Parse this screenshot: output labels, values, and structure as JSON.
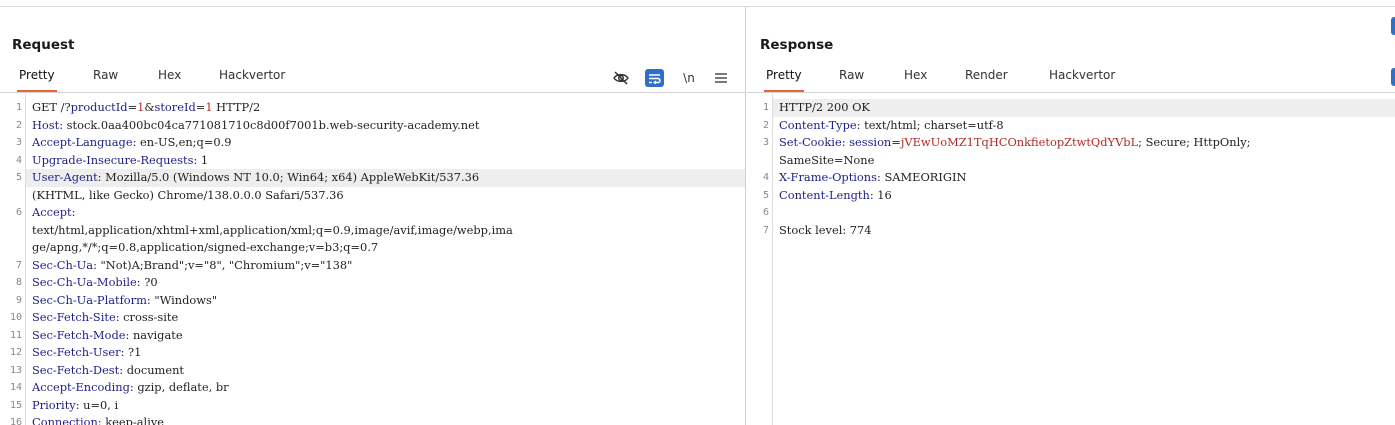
{
  "request": {
    "title": "Request",
    "tabs": [
      "Pretty",
      "Raw",
      "Hex",
      "Hackvertor"
    ],
    "active_tab": "Pretty",
    "toolbar": {
      "newline_label": "\\n"
    },
    "lines": [
      {
        "n": "1",
        "parts": [
          [
            "t",
            "GET /?"
          ],
          [
            "p",
            "productId"
          ],
          [
            "t",
            "="
          ],
          [
            "v",
            "1"
          ],
          [
            "t",
            "&"
          ],
          [
            "p",
            "storeId"
          ],
          [
            "t",
            "="
          ],
          [
            "v",
            "1"
          ],
          [
            "t",
            " HTTP/2"
          ]
        ]
      },
      {
        "n": "2",
        "parts": [
          [
            "h",
            "Host"
          ],
          [
            "t",
            ": stock.0aa400bc04ca771081710c8d00f7001b.web-security-academy.net"
          ]
        ]
      },
      {
        "n": "3",
        "parts": [
          [
            "h",
            "Accept-Language"
          ],
          [
            "t",
            ": en-US,en;q=0.9"
          ]
        ]
      },
      {
        "n": "4",
        "parts": [
          [
            "h",
            "Upgrade-Insecure-Requests"
          ],
          [
            "t",
            ": 1"
          ]
        ]
      },
      {
        "n": "5",
        "parts": [
          [
            "h",
            "User-Agent"
          ],
          [
            "t",
            ": Mozilla/5.0 (Windows NT 10.0; Win64; x64) AppleWebKit/537.36"
          ]
        ],
        "hl": true
      },
      {
        "n": "",
        "parts": [
          [
            "t",
            "(KHTML, like Gecko) Chrome/138.0.0.0 Safari/537.36"
          ]
        ]
      },
      {
        "n": "6",
        "parts": [
          [
            "h",
            "Accept"
          ],
          [
            "t",
            ":"
          ]
        ]
      },
      {
        "n": "",
        "parts": [
          [
            "t",
            "text/html,application/xhtml+xml,application/xml;q=0.9,image/avif,image/webp,ima"
          ]
        ]
      },
      {
        "n": "",
        "parts": [
          [
            "t",
            "ge/apng,*/*;q=0.8,application/signed-exchange;v=b3;q=0.7"
          ]
        ]
      },
      {
        "n": "7",
        "parts": [
          [
            "h",
            "Sec-Ch-Ua"
          ],
          [
            "t",
            ": \"Not)A;Brand\";v=\"8\", \"Chromium\";v=\"138\""
          ]
        ]
      },
      {
        "n": "8",
        "parts": [
          [
            "h",
            "Sec-Ch-Ua-Mobile"
          ],
          [
            "t",
            ": ?0"
          ]
        ]
      },
      {
        "n": "9",
        "parts": [
          [
            "h",
            "Sec-Ch-Ua-Platform"
          ],
          [
            "t",
            ": \"Windows\""
          ]
        ]
      },
      {
        "n": "10",
        "parts": [
          [
            "h",
            "Sec-Fetch-Site"
          ],
          [
            "t",
            ": cross-site"
          ]
        ]
      },
      {
        "n": "11",
        "parts": [
          [
            "h",
            "Sec-Fetch-Mode"
          ],
          [
            "t",
            ": navigate"
          ]
        ]
      },
      {
        "n": "12",
        "parts": [
          [
            "h",
            "Sec-Fetch-User"
          ],
          [
            "t",
            ": ?1"
          ]
        ]
      },
      {
        "n": "13",
        "parts": [
          [
            "h",
            "Sec-Fetch-Dest"
          ],
          [
            "t",
            ": document"
          ]
        ]
      },
      {
        "n": "14",
        "parts": [
          [
            "h",
            "Accept-Encoding"
          ],
          [
            "t",
            ": gzip, deflate, br"
          ]
        ]
      },
      {
        "n": "15",
        "parts": [
          [
            "h",
            "Priority"
          ],
          [
            "t",
            ": u=0, i"
          ]
        ]
      },
      {
        "n": "16",
        "parts": [
          [
            "h",
            "Connection"
          ],
          [
            "t",
            ": keep-alive"
          ]
        ]
      }
    ]
  },
  "response": {
    "title": "Response",
    "tabs": [
      "Pretty",
      "Raw",
      "Hex",
      "Render",
      "Hackvertor"
    ],
    "active_tab": "Pretty",
    "lines": [
      {
        "n": "1",
        "parts": [
          [
            "t",
            "HTTP/2 200 OK"
          ]
        ],
        "hl": true
      },
      {
        "n": "2",
        "parts": [
          [
            "h",
            "Content-Type"
          ],
          [
            "t",
            ": text/html; charset=utf-8"
          ]
        ]
      },
      {
        "n": "3",
        "parts": [
          [
            "h",
            "Set-Cookie"
          ],
          [
            "t",
            ": "
          ],
          [
            "p",
            "session"
          ],
          [
            "t",
            "="
          ],
          [
            "v",
            "jVEwUoMZ1TqHCOnkfietopZtwtQdYVbL"
          ],
          [
            "t",
            "; Secure; HttpOnly;"
          ]
        ]
      },
      {
        "n": "",
        "parts": [
          [
            "t",
            "SameSite=None"
          ]
        ]
      },
      {
        "n": "4",
        "parts": [
          [
            "h",
            "X-Frame-Options"
          ],
          [
            "t",
            ": SAMEORIGIN"
          ]
        ]
      },
      {
        "n": "5",
        "parts": [
          [
            "h",
            "Content-Length"
          ],
          [
            "t",
            ": 16"
          ]
        ]
      },
      {
        "n": "6",
        "parts": []
      },
      {
        "n": "7",
        "parts": [
          [
            "t",
            "Stock level: 774"
          ]
        ]
      }
    ]
  },
  "colors": {
    "accent": "#e8653a",
    "header_name": "#1e1e8a",
    "param_value": "#b22a2a",
    "wrap_button": "#2f6fc6"
  },
  "icons": [
    "hide-eye-icon",
    "wrap-lines-icon",
    "newline-toggle",
    "menu-icon"
  ]
}
